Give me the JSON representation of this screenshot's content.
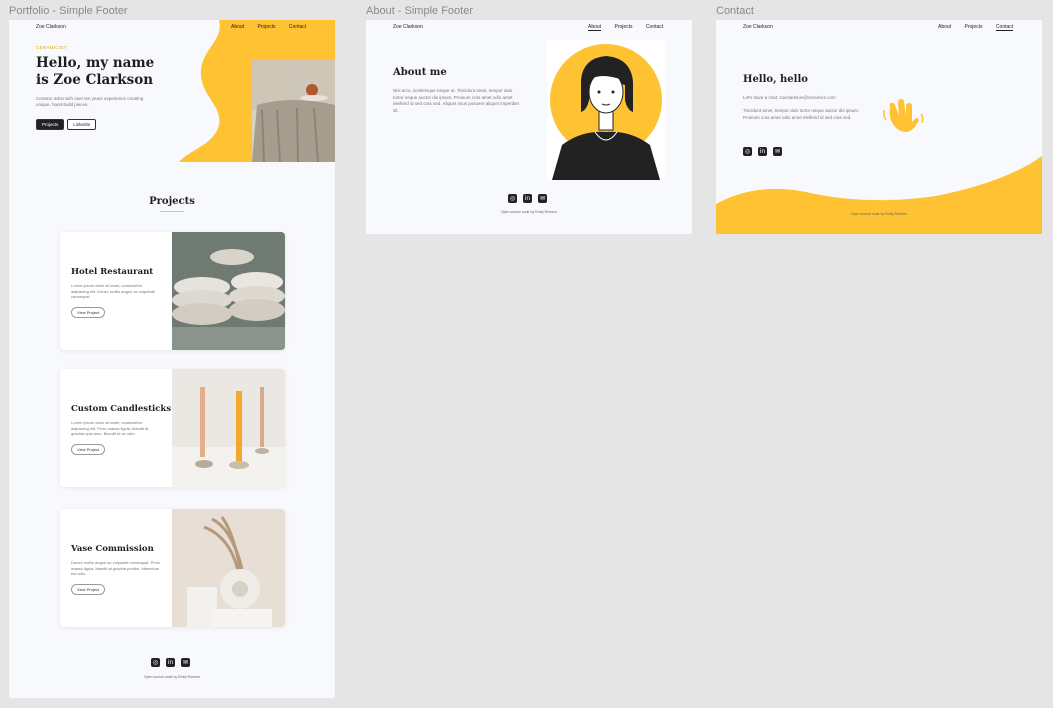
{
  "frames": {
    "portfolio_label": "Portfolio - Simple Footer",
    "about_label": "About - Simple Footer",
    "contact_label": "Contact"
  },
  "portfolio": {
    "logo": "Zoe Clarkson",
    "nav": [
      "About",
      "Projects",
      "Contact"
    ],
    "eyebrow": "CERAMICIST",
    "hero_line1": "Hello, my name",
    "hero_line2": "is Zoe Clarkson",
    "hero_text": "Ceramic artist with over ten years experience creating unique, hand-build pieces.",
    "btn_projects": "Projects",
    "btn_linkedin": "LinkedIn",
    "projects_heading": "Projects",
    "cards": [
      {
        "title": "Hotel Restaurant",
        "text": "Lorem ipsum dolor sit amet, consectetur adipiscing elit. Donec mollis augue ac vulputate consequat.",
        "button": "View Project"
      },
      {
        "title": "Custom Candlesticks",
        "text": "Lorem ipsum dolor sit amet, consectetur adipiscing elit. Proin massa ligula, blandit at gravida quis arcu. Blandit et ac odio.",
        "button": "View Project"
      },
      {
        "title": "Vase Commission",
        "text": "Donec mollis augue ac vulputate consequat. Proin massa ligula, blandit at gravida portitor, bibendum est odio.",
        "button": "View Project"
      }
    ],
    "footer_credit": "Open source code by Emily Romero"
  },
  "about": {
    "logo": "Zoe Clarkson",
    "nav": [
      "About",
      "Projects",
      "Contact"
    ],
    "heading": "About me",
    "text": "Nisi arcu, scelerisque neque ut. Tincidunt amet, tempor duis tortor neque auctor dis ipsum. Proinum cras amet odio amet eleifend id sed cras sed. Aliquet risus posuere aliquet imperdiet sit.",
    "footer_credit": "Open source code by Emily Romero"
  },
  "contact": {
    "logo": "Zoe Clarkson",
    "nav": [
      "About",
      "Projects",
      "Contact"
    ],
    "heading": "Hello, hello",
    "line1": "Let's have a chat: zoeclarkson@ceramics.com",
    "text": "Tincidunt amet, tempor duis tortor neque auctor dis ipsum. Proinum cras amet odio amet eleifend id sed cras sed.",
    "footer_credit": "Open source code by Emily Romero"
  },
  "colors": {
    "accent": "#ffc233",
    "dark": "#222222",
    "frame_bg": "#f8f9fd",
    "canvas_bg": "#e5e5e5"
  },
  "icons": [
    "instagram-icon",
    "linkedin-icon",
    "mail-icon",
    "waving-hand-icon"
  ]
}
